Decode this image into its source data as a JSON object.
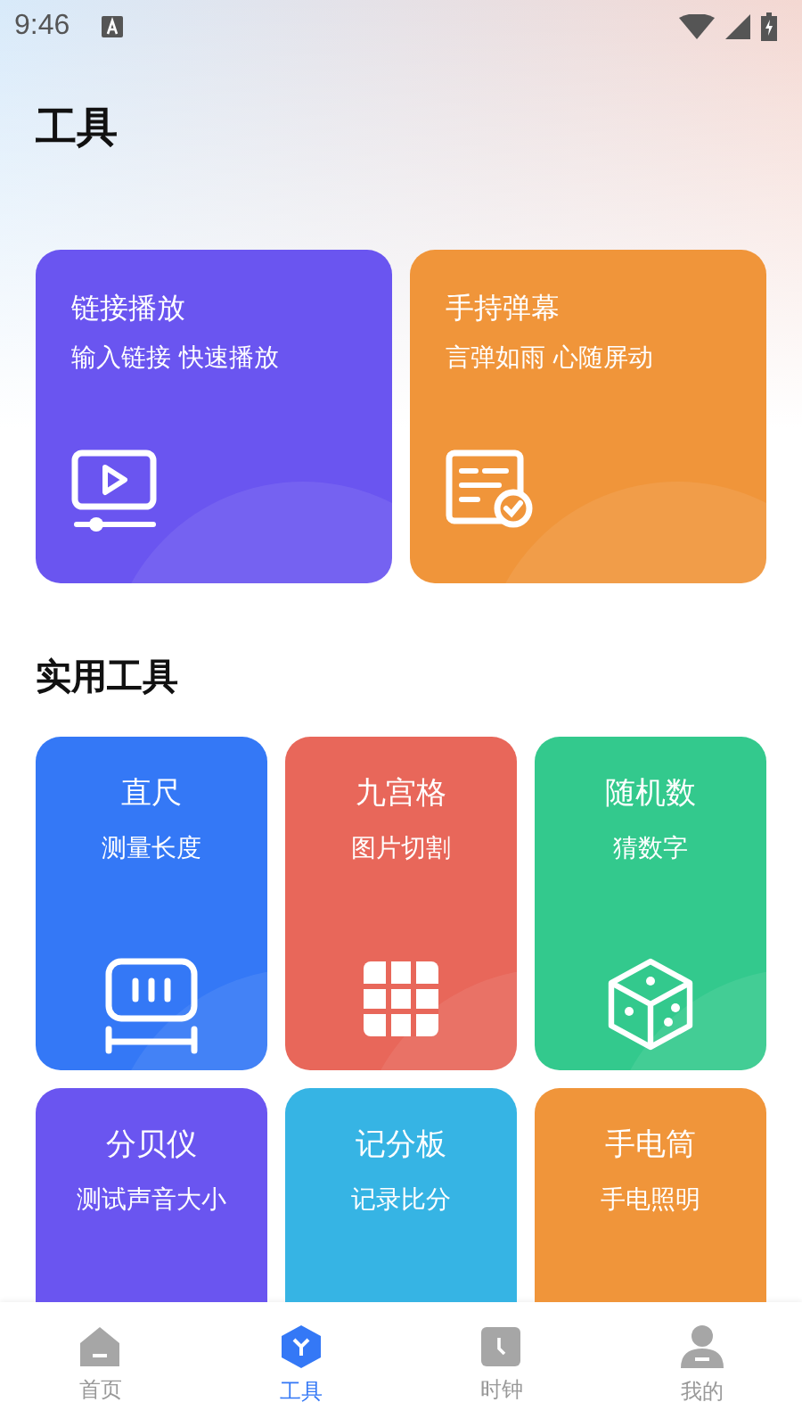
{
  "status_bar": {
    "time": "9:46"
  },
  "title": "工具",
  "features": [
    {
      "title": "链接播放",
      "subtitle": "输入链接 快速播放",
      "color": "#6a55f0"
    },
    {
      "title": "手持弹幕",
      "subtitle": "言弹如雨 心随屏动",
      "color": "#f0953a"
    }
  ],
  "section_title": "实用工具",
  "tools": [
    {
      "title": "直尺",
      "subtitle": "测量长度",
      "color": "#3478f6"
    },
    {
      "title": "九宫格",
      "subtitle": "图片切割",
      "color": "#e8675a"
    },
    {
      "title": "随机数",
      "subtitle": "猜数字",
      "color": "#33c98d"
    },
    {
      "title": "分贝仪",
      "subtitle": "测试声音大小",
      "color": "#6a55f0"
    },
    {
      "title": "记分板",
      "subtitle": "记录比分",
      "color": "#36b4e4"
    },
    {
      "title": "手电筒",
      "subtitle": "手电照明",
      "color": "#f0953a"
    }
  ],
  "nav": [
    {
      "label": "首页",
      "selected": false
    },
    {
      "label": "工具",
      "selected": true
    },
    {
      "label": "时钟",
      "selected": false
    },
    {
      "label": "我的",
      "selected": false
    }
  ]
}
